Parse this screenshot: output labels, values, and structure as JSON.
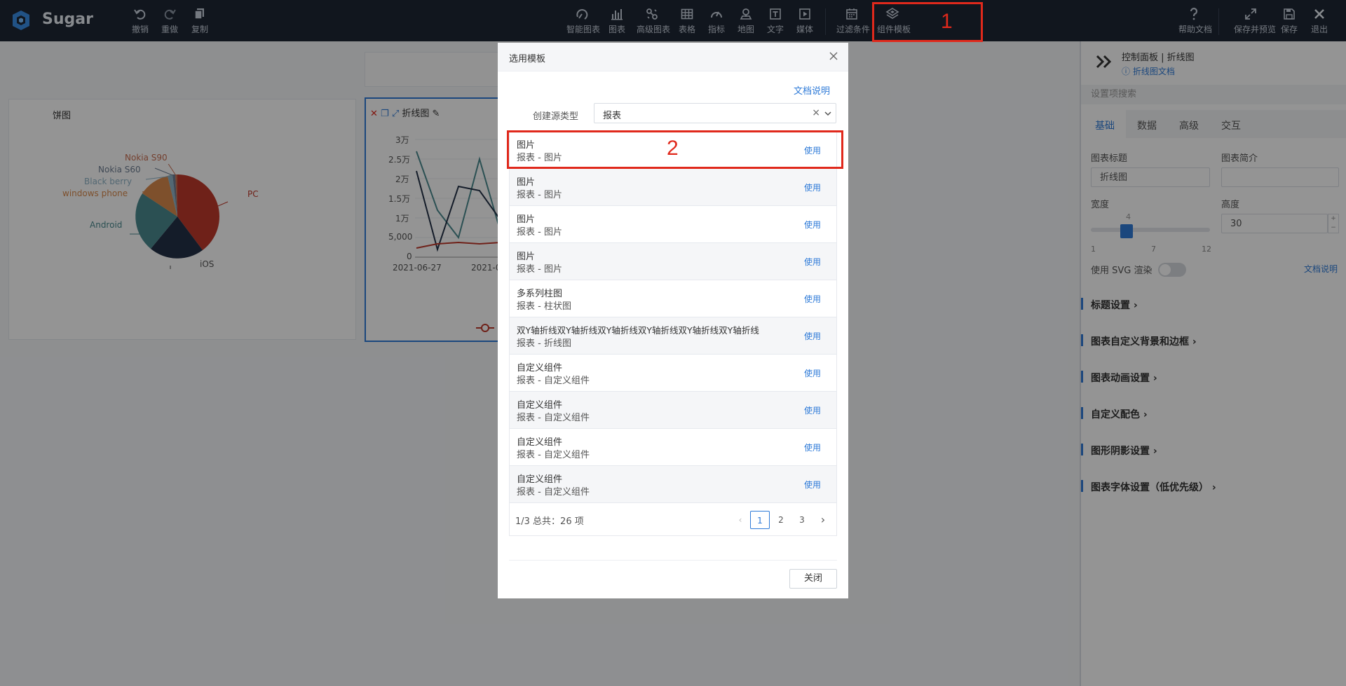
{
  "app": {
    "name": "Sugar"
  },
  "toolbar": {
    "left": [
      {
        "label": "撤销",
        "icon": "undo-icon"
      },
      {
        "label": "重做",
        "icon": "redo-icon"
      },
      {
        "label": "复制",
        "icon": "copy-icon"
      }
    ],
    "center": [
      {
        "label": "智能图表",
        "icon": "smart-chart-icon"
      },
      {
        "label": "图表",
        "icon": "bar-chart-icon"
      },
      {
        "label": "高级图表",
        "icon": "advanced-chart-icon"
      },
      {
        "label": "表格",
        "icon": "table-icon"
      },
      {
        "label": "指标",
        "icon": "gauge-icon"
      },
      {
        "label": "地图",
        "icon": "map-pin-icon"
      },
      {
        "label": "文字",
        "icon": "text-icon"
      },
      {
        "label": "媒体",
        "icon": "media-icon"
      },
      {
        "label": "过滤条件",
        "icon": "filter-calendar-icon"
      },
      {
        "label": "组件模板",
        "icon": "component-template-icon"
      }
    ],
    "right": [
      {
        "label": "帮助文档",
        "icon": "help-icon"
      },
      {
        "label": "保存并预览",
        "icon": "expand-icon"
      },
      {
        "label": "保存",
        "icon": "save-icon"
      },
      {
        "label": "退出",
        "icon": "close-icon"
      }
    ]
  },
  "canvas": {
    "pie": {
      "title": "饼图",
      "labels": [
        "Nokia S90",
        "Nokia S60",
        "Black berry",
        "windows phone",
        "Android",
        "iOS",
        "PC"
      ]
    },
    "line": {
      "title": "折线图",
      "y_ticks": [
        "3万",
        "2.5万",
        "2万",
        "1.5万",
        "1万",
        "5,000",
        "0"
      ],
      "x_ticks": [
        "2021-06-27",
        "2021-0"
      ]
    }
  },
  "right_panel": {
    "header_title": "控制面板 | 折线图",
    "header_link": "折线图文档",
    "search_placeholder": "设置项搜索",
    "tabs": [
      "基础",
      "数据",
      "高级",
      "交互"
    ],
    "chart_title_label": "图表标题",
    "chart_title_value": "折线图",
    "chart_desc_label": "图表简介",
    "width_label": "宽度",
    "width_value": "4",
    "width_ticks": [
      "1",
      "7",
      "12"
    ],
    "height_label": "高度",
    "height_value": "30",
    "svg_label": "使用 SVG 渲染",
    "doc_link": "文档说明",
    "sections": [
      "标题设置",
      "图表自定义背景和边框",
      "图表动画设置",
      "自定义配色",
      "图形阴影设置",
      "图表字体设置（低优先级）"
    ]
  },
  "modal": {
    "title": "选用模板",
    "doc_link": "文档说明",
    "source_label": "创建源类型",
    "source_value": "报表",
    "use_label": "使用",
    "items": [
      {
        "title": "图片",
        "subtitle": "报表 - 图片"
      },
      {
        "title": "图片",
        "subtitle": "报表 - 图片"
      },
      {
        "title": "图片",
        "subtitle": "报表 - 图片"
      },
      {
        "title": "图片",
        "subtitle": "报表 - 图片"
      },
      {
        "title": "多系列柱图",
        "subtitle": "报表 - 柱状图"
      },
      {
        "title": "双Y轴折线双Y轴折线双Y轴折线双Y轴折线双Y轴折线双Y轴折线",
        "subtitle": "报表 - 折线图"
      },
      {
        "title": "自定义组件",
        "subtitle": "报表 - 自定义组件"
      },
      {
        "title": "自定义组件",
        "subtitle": "报表 - 自定义组件"
      },
      {
        "title": "自定义组件",
        "subtitle": "报表 - 自定义组件"
      },
      {
        "title": "自定义组件",
        "subtitle": "报表 - 自定义组件"
      }
    ],
    "pagination": {
      "summary": "1/3 总共：26 项",
      "pages": [
        "1",
        "2",
        "3"
      ],
      "current": "1"
    },
    "close_label": "关闭"
  },
  "annotations": [
    "1",
    "2"
  ],
  "colors": {
    "accent": "#2f7bd8",
    "annotation": "#e0291c",
    "topbar": "#1e2635"
  }
}
